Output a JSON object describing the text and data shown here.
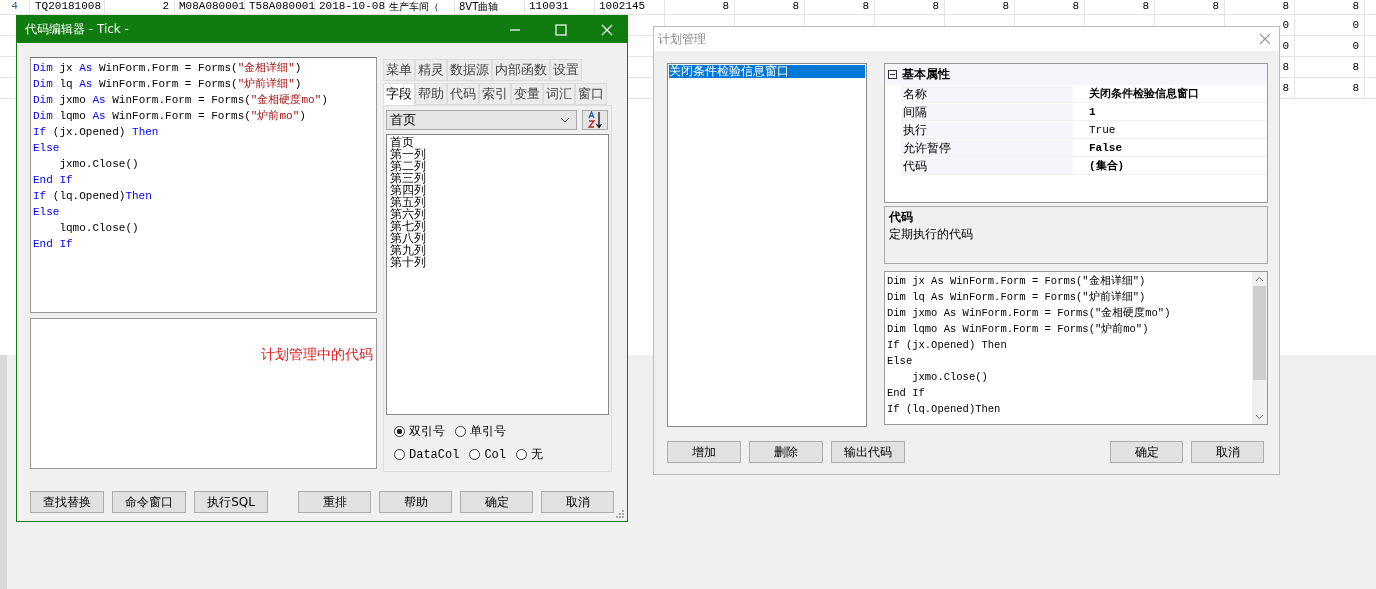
{
  "sheet": {
    "rows": [
      {
        "cells": [
          "4",
          "TQ20181008",
          "2",
          "M08A080001",
          "T58A080001",
          "2018-10-08",
          "生产车间（",
          "8VT曲轴",
          "110031",
          "1002145",
          "8",
          "8",
          "8",
          "8",
          "8",
          "8",
          "8",
          "8",
          "8",
          "8"
        ]
      },
      {
        "cells": [
          "0",
          "0"
        ]
      },
      {
        "cells": [
          "0",
          "0"
        ]
      },
      {
        "cells": [
          "8",
          "8"
        ]
      },
      {
        "cells": [
          "8",
          "8"
        ]
      }
    ]
  },
  "code_editor": {
    "title": "代码编辑器 - Tick -",
    "code_lines": [
      [
        {
          "text": "Dim",
          "kind": "keyword"
        },
        {
          "text": " jx ",
          "kind": "plain"
        },
        {
          "text": "As",
          "kind": "keyword"
        },
        {
          "text": " WinForm.Form = Forms(",
          "kind": "plain"
        },
        {
          "text": "\"金相详细\"",
          "kind": "string"
        },
        {
          "text": ")",
          "kind": "plain"
        }
      ],
      [
        {
          "text": "Dim",
          "kind": "keyword"
        },
        {
          "text": " lq ",
          "kind": "plain"
        },
        {
          "text": "As",
          "kind": "keyword"
        },
        {
          "text": " WinForm.Form = Forms(",
          "kind": "plain"
        },
        {
          "text": "\"炉前详细\"",
          "kind": "string"
        },
        {
          "text": ")",
          "kind": "plain"
        }
      ],
      [
        {
          "text": "Dim",
          "kind": "keyword"
        },
        {
          "text": " jxmo ",
          "kind": "plain"
        },
        {
          "text": "As",
          "kind": "keyword"
        },
        {
          "text": " WinForm.Form = Forms(",
          "kind": "plain"
        },
        {
          "text": "\"金相硬度mo\"",
          "kind": "string"
        },
        {
          "text": ")",
          "kind": "plain"
        }
      ],
      [
        {
          "text": "Dim",
          "kind": "keyword"
        },
        {
          "text": " lqmo ",
          "kind": "plain"
        },
        {
          "text": "As",
          "kind": "keyword"
        },
        {
          "text": " WinForm.Form = Forms(",
          "kind": "plain"
        },
        {
          "text": "\"炉前mo\"",
          "kind": "string"
        },
        {
          "text": ")",
          "kind": "plain"
        }
      ],
      [
        {
          "text": "If",
          "kind": "keyword"
        },
        {
          "text": " (jx.Opened) ",
          "kind": "plain"
        },
        {
          "text": "Then",
          "kind": "keyword"
        }
      ],
      [
        {
          "text": "Else",
          "kind": "keyword"
        }
      ],
      [
        {
          "text": "    jxmo.Close()",
          "kind": "plain"
        }
      ],
      [
        {
          "text": "End If",
          "kind": "keyword"
        }
      ],
      [
        {
          "text": "If",
          "kind": "keyword"
        },
        {
          "text": " (lq.Opened)",
          "kind": "plain"
        },
        {
          "text": "Then",
          "kind": "keyword"
        }
      ],
      [
        {
          "text": "Else",
          "kind": "keyword"
        }
      ],
      [
        {
          "text": "    lqmo.Close()",
          "kind": "plain"
        }
      ],
      [
        {
          "text": "End If",
          "kind": "keyword"
        }
      ]
    ],
    "note": "计划管理中的代码",
    "tab_rows": [
      [
        {
          "label": "菜单",
          "selected": false
        },
        {
          "label": "精灵",
          "selected": false
        },
        {
          "label": "数据源",
          "selected": false
        },
        {
          "label": "内部函数",
          "selected": false
        },
        {
          "label": "设置",
          "selected": false
        }
      ],
      [
        {
          "label": "字段",
          "selected": true
        },
        {
          "label": "帮助",
          "selected": false
        },
        {
          "label": "代码",
          "selected": false
        },
        {
          "label": "索引",
          "selected": false
        },
        {
          "label": "变量",
          "selected": false
        },
        {
          "label": "词汇",
          "selected": false
        },
        {
          "label": "窗口",
          "selected": false
        }
      ]
    ],
    "combo": {
      "value": "首页"
    },
    "fields": [
      "首页",
      "第一列",
      "第二列",
      "第三列",
      "第四列",
      "第五列",
      "第六列",
      "第七列",
      "第八列",
      "第九列",
      "第十列"
    ],
    "radios": [
      {
        "label": "双引号",
        "checked": true
      },
      {
        "label": "单引号",
        "checked": false
      },
      {
        "label": "DataCol",
        "checked": false
      },
      {
        "label": "Col",
        "checked": false
      },
      {
        "label": "无",
        "checked": false
      }
    ],
    "left_buttons": [
      "查找替换",
      "命令窗口",
      "执行SQL"
    ],
    "right_buttons": [
      "重排",
      "帮助",
      "确定",
      "取消"
    ]
  },
  "plan_manager": {
    "title": "计划管理",
    "plans": [
      {
        "label": "关闭条件检验信息窗口",
        "selected": true
      }
    ],
    "properties": {
      "category": "基本属性",
      "expanded": true,
      "rows": [
        {
          "label": "名称",
          "value": "关闭条件检验信息窗口",
          "bold": true
        },
        {
          "label": "间隔",
          "value": "1",
          "bold": true
        },
        {
          "label": "执行",
          "value": "True",
          "bold": false
        },
        {
          "label": "允许暂停",
          "value": "False",
          "bold": true
        },
        {
          "label": "代码",
          "value": "(集合)",
          "bold": true
        }
      ]
    },
    "description": {
      "title": "代码",
      "text": "定期执行的代码"
    },
    "code_lines": [
      "Dim jx As WinForm.Form = Forms(\"金相详细\")",
      "Dim lq As WinForm.Form = Forms(\"炉前详细\")",
      "Dim jxmo As WinForm.Form = Forms(\"金相硬度mo\")",
      "Dim lqmo As WinForm.Form = Forms(\"炉前mo\")",
      "If (jx.Opened) Then",
      "Else",
      "    jxmo.Close()",
      "End If",
      "If (lq.Opened)Then"
    ],
    "left_buttons": [
      "增加",
      "删除",
      "输出代码"
    ],
    "right_buttons": [
      "确定",
      "取消"
    ]
  }
}
